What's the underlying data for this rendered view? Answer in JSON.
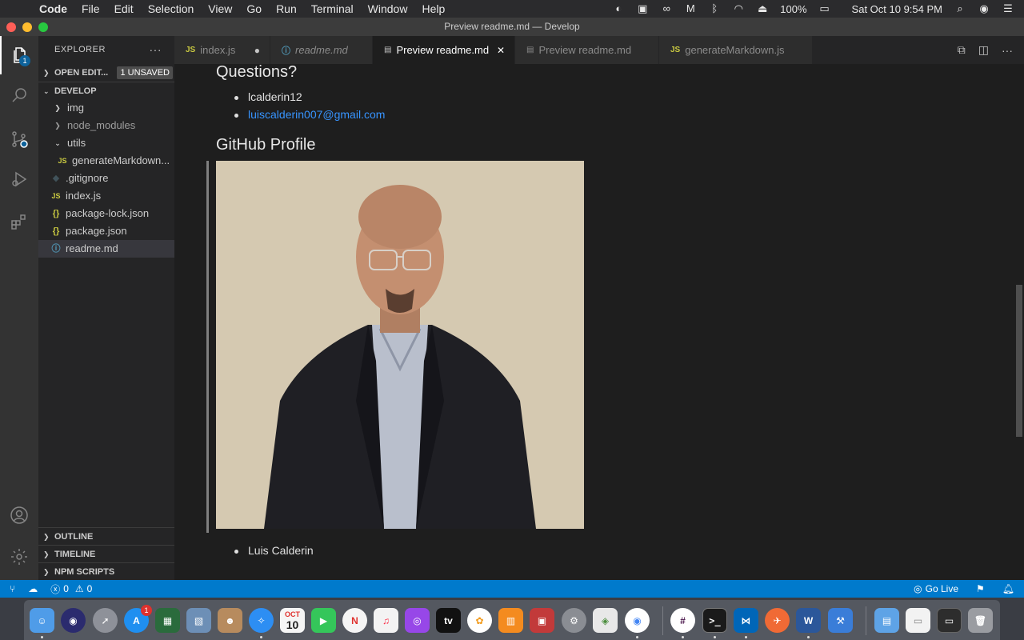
{
  "menubar": {
    "app": "Code",
    "items": [
      "File",
      "Edit",
      "Selection",
      "View",
      "Go",
      "Run",
      "Terminal",
      "Window",
      "Help"
    ],
    "battery": "100%",
    "datetime": "Sat Oct 10  9:54 PM"
  },
  "window": {
    "title": "Preview readme.md — Develop"
  },
  "activity": {
    "explorer_badge": "1"
  },
  "sidebar": {
    "header": "EXPLORER",
    "open_editors": "OPEN EDIT...",
    "unsaved_badge": "1 UNSAVED",
    "folder": "DEVELOP",
    "items": [
      {
        "label": "img",
        "type": "folder"
      },
      {
        "label": "node_modules",
        "type": "folder"
      },
      {
        "label": "utils",
        "type": "folder-open"
      },
      {
        "label": "generateMarkdown...",
        "type": "js"
      },
      {
        "label": ".gitignore",
        "type": "git"
      },
      {
        "label": "index.js",
        "type": "js"
      },
      {
        "label": "package-lock.json",
        "type": "json"
      },
      {
        "label": "package.json",
        "type": "json"
      },
      {
        "label": "readme.md",
        "type": "info"
      }
    ],
    "outline": "OUTLINE",
    "timeline": "TIMELINE",
    "npm_scripts": "NPM SCRIPTS"
  },
  "tabs": [
    {
      "label": "index.js",
      "icon": "JS",
      "trail": "●",
      "active": false,
      "italic": false
    },
    {
      "label": "readme.md",
      "icon": "ⓘ",
      "trail": "",
      "active": false,
      "italic": true
    },
    {
      "label": "Preview readme.md",
      "icon": "▤",
      "trail": "✕",
      "active": true,
      "italic": false
    },
    {
      "label": "Preview readme.md",
      "icon": "▤",
      "trail": "",
      "active": false,
      "italic": false
    },
    {
      "label": "generateMarkdown.js",
      "icon": "JS",
      "trail": "",
      "active": false,
      "italic": false
    }
  ],
  "preview": {
    "questions_heading": "Questions?",
    "username": "lcalderin12",
    "email": "luiscalderin007@gmail.com",
    "profile_heading": "GitHub Profile",
    "name": "Luis Calderin"
  },
  "statusbar": {
    "errors": "0",
    "warnings": "0",
    "go_live": "Go Live"
  },
  "dock": {
    "calendar_month": "OCT",
    "calendar_day": "10",
    "appstore_badge": "1"
  }
}
